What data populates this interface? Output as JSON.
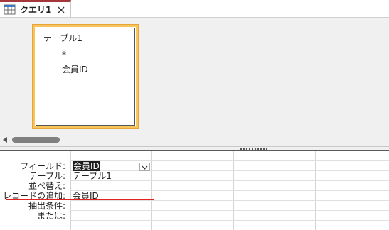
{
  "tab": {
    "label": "クエリ1"
  },
  "table_box": {
    "title": "テーブル1",
    "fields": [
      "*",
      "会員ID"
    ]
  },
  "grid": {
    "row_labels": [
      "フィールド:",
      "テーブル:",
      "並べ替え:",
      "レコードの追加:",
      "抽出条件:",
      "または:"
    ],
    "col1": {
      "field": "会員ID",
      "table": "テーブル1",
      "append_to": "会員ID"
    }
  },
  "colors": {
    "tab_accent": "#a4373a",
    "table_highlight": "#f8c55a",
    "annotation": "#e32222"
  }
}
